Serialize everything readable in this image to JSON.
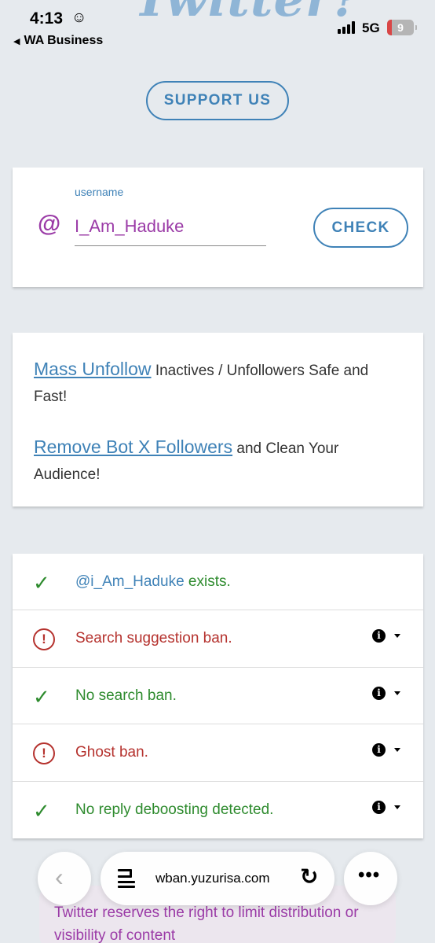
{
  "status_bar": {
    "time": "4:13",
    "back_app": "WA Business",
    "network": "5G",
    "battery": "9",
    "bg_logo": "Twitter?"
  },
  "support_button": "SUPPORT US",
  "check_card": {
    "at_symbol": "@",
    "field_label": "username",
    "username_value": "I_Am_Haduke",
    "check_button": "CHECK"
  },
  "promo": {
    "line1_link": "Mass Unfollow",
    "line1_text": " Inactives / Unfollowers Safe and Fast!",
    "line2_link": "Remove Bot X Followers",
    "line2_text": " and Clean Your Audience!"
  },
  "results": [
    {
      "status": "ok",
      "handle": "@i_Am_Haduke",
      "text": " exists.",
      "has_info": false
    },
    {
      "status": "bad",
      "handle": "",
      "text": "Search suggestion ban.",
      "has_info": true
    },
    {
      "status": "ok",
      "handle": "",
      "text": "No search ban.",
      "has_info": true
    },
    {
      "status": "bad",
      "handle": "",
      "text": "Ghost ban.",
      "has_info": true
    },
    {
      "status": "ok",
      "handle": "",
      "text": "No reply deboosting detected.",
      "has_info": true
    }
  ],
  "bottom": {
    "notice": "Twitter reserves the right to limit distribution or visibility of content",
    "url": "wban.yuzurisa.com"
  },
  "colors": {
    "accent_blue": "#3f82b7",
    "purple": "#9b3ba7",
    "success_green": "#2e8b2e",
    "error_red": "#b5322e",
    "page_bg": "#e6eaee"
  },
  "icons": {
    "back_arrow": "chevron-left-icon",
    "tabs": "tabs-icon",
    "reload": "reload-icon",
    "more": "more-icon",
    "check": "check-icon",
    "warning": "warning-icon",
    "info": "info-icon",
    "dropdown": "dropdown-caret-icon"
  }
}
